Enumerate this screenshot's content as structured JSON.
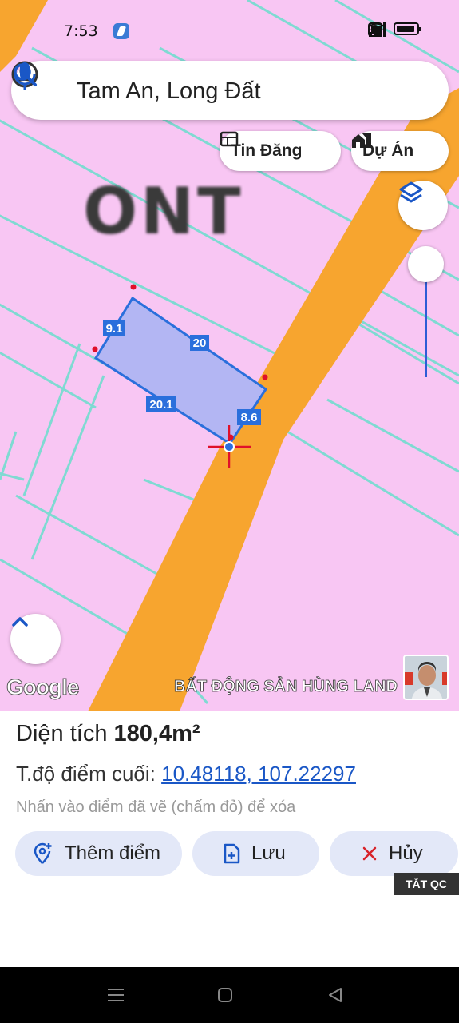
{
  "status_bar": {
    "time": "7:53"
  },
  "search": {
    "query": "Tam An, Long Đất"
  },
  "chips": {
    "news_label": "Tin Đăng",
    "projects_label": "Dự Án"
  },
  "map": {
    "zoning_label": "ONT",
    "google_label": "Google",
    "brand_label": "BẤT ĐỘNG SẢN HÙNG LAND",
    "parcel_edges": {
      "top_left": "9.1",
      "top": "20",
      "bottom": "20.1",
      "right": "8.6"
    },
    "colors": {
      "land": "#f8c6f3",
      "road": "#f7a52f",
      "parcel_lines": "#7fdad2",
      "polygon_fill": "#b3b6f3",
      "polygon_stroke": "#2a6fdc",
      "vertex": "#e0102a"
    }
  },
  "panel": {
    "area_prefix": "Diện tích",
    "area_value": "180,4m²",
    "coord_prefix": "T.độ điểm cuối:",
    "coord_value": "10.48118, 107.22297",
    "hint": "Nhấn vào điểm đã vẽ (chấm đỏ) để xóa",
    "add_point_label": "Thêm điểm",
    "save_label": "Lưu",
    "cancel_label": "Hủy",
    "ad_label": "TẮT QC"
  }
}
